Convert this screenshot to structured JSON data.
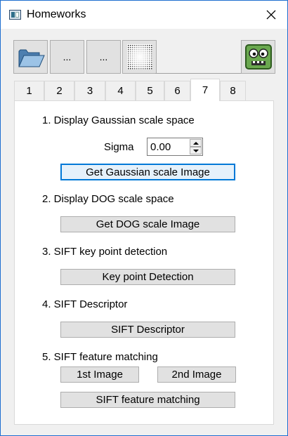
{
  "window": {
    "title": "Homeworks"
  },
  "toolbar": {
    "btn2_label": "...",
    "btn3_label": "..."
  },
  "tabs": [
    "1",
    "2",
    "3",
    "4",
    "5",
    "6",
    "7",
    "8"
  ],
  "active_tab": "7",
  "panel": {
    "section1": "1. Display Gaussian scale space",
    "sigma_label": "Sigma",
    "sigma_value": "0.00",
    "btn_gaussian": "Get Gaussian scale Image",
    "section2": "2. Display DOG scale space",
    "btn_dog": "Get DOG scale Image",
    "section3": "3. SIFT key point detection",
    "btn_keypoint": "Key point Detection",
    "section4": "4. SIFT Descriptor",
    "btn_descriptor": "SIFT Descriptor",
    "section5": "5. SIFT feature matching",
    "btn_img1": "1st Image",
    "btn_img2": "2nd Image",
    "btn_matching": "SIFT feature matching"
  },
  "colors": {
    "accent": "#0078d7",
    "window_border": "#1e6fd0"
  }
}
